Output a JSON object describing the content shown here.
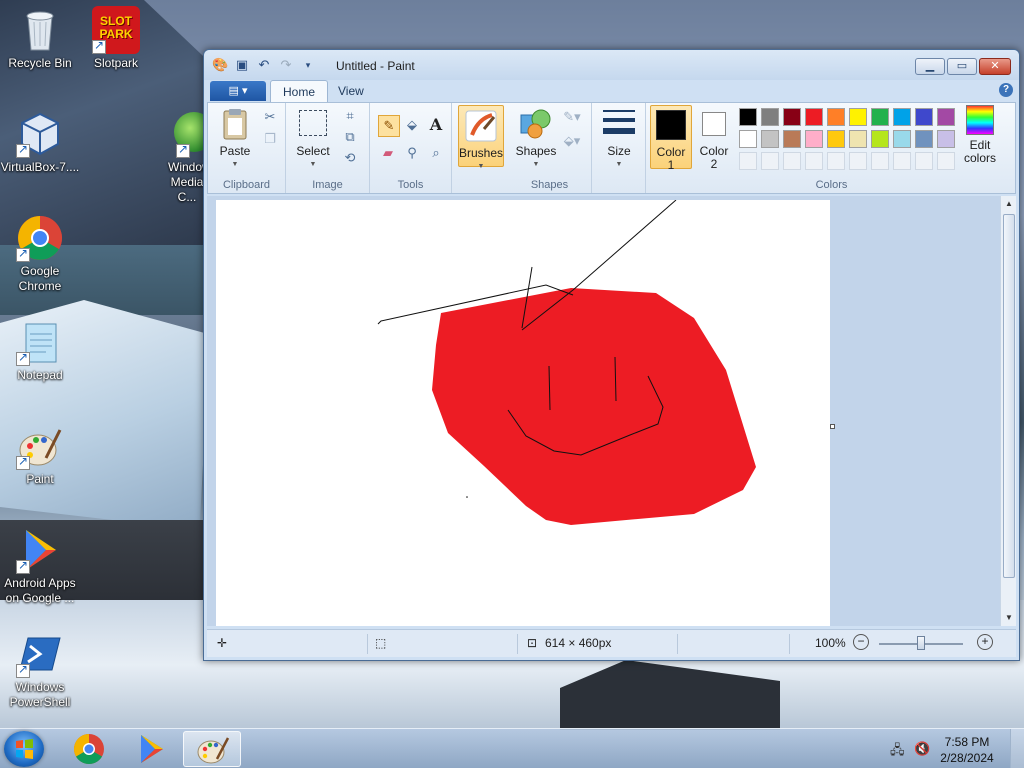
{
  "desktop": {
    "icons": [
      {
        "label": "Recycle Bin"
      },
      {
        "label": "Slotpark",
        "logo_text": "SLOT PARK"
      },
      {
        "label": "VirtualBox-7...."
      },
      {
        "label": "Windows Media C..."
      },
      {
        "label": "Google Chrome"
      },
      {
        "label": "Notepad"
      },
      {
        "label": "Paint"
      },
      {
        "label": "Android Apps on Google ..."
      },
      {
        "label": "Windows PowerShell"
      }
    ]
  },
  "paint": {
    "title": "Untitled - Paint",
    "tabs": [
      "Home",
      "View"
    ],
    "groups": {
      "clipboard": {
        "label": "Clipboard",
        "paste": "Paste"
      },
      "image": {
        "label": "Image",
        "select": "Select"
      },
      "tools": {
        "label": "Tools"
      },
      "brushes": {
        "label": "Brushes"
      },
      "shapes": {
        "label": "Shapes",
        "shapes": "Shapes"
      },
      "size": {
        "label": "Size"
      },
      "colors": {
        "label": "Colors",
        "color1": "Color 1",
        "color1_line1": "Color",
        "color1_line2": "1",
        "color2_line1": "Color",
        "color2_line2": "2",
        "edit_line1": "Edit",
        "edit_line2": "colors"
      }
    },
    "palette_row1": [
      "#000000",
      "#7f7f7f",
      "#880015",
      "#ed1c24",
      "#ff7f27",
      "#fff200",
      "#22b14c",
      "#00a2e8",
      "#3f48cc",
      "#a349a4"
    ],
    "palette_row2": [
      "#ffffff",
      "#c3c3c3",
      "#b97a57",
      "#ffaec9",
      "#ffc90e",
      "#efe4b0",
      "#b5e61d",
      "#99d9ea",
      "#7092be",
      "#c8bfe7"
    ],
    "color1_value": "#000000",
    "color2_value": "#ffffff",
    "status": {
      "canvas_size": "614 × 460px",
      "zoom": "100%"
    }
  },
  "taskbar": {
    "time": "7:58 PM",
    "date": "2/28/2024"
  }
}
